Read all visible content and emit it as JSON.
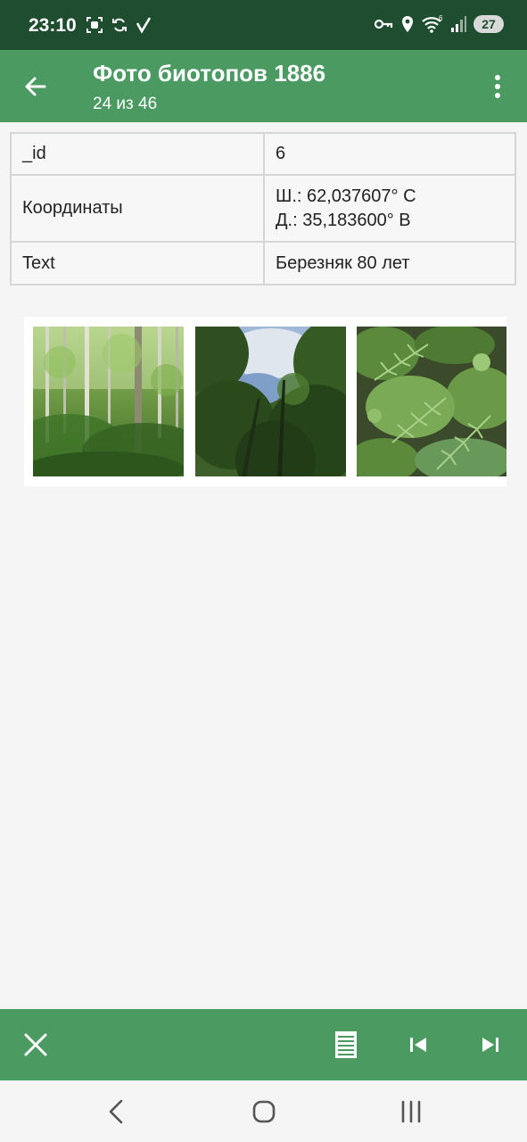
{
  "status_bar": {
    "time": "23:10",
    "battery": "27",
    "left_icons": [
      "screen-record-icon",
      "sync-icon",
      "checkmark-icon"
    ],
    "right_icons": [
      "vpn-key-icon",
      "location-icon",
      "wifi-icon",
      "signal-icon",
      "battery-icon"
    ]
  },
  "app_bar": {
    "title": "Фото биотопов 1886",
    "subtitle": "24 из 46",
    "back_icon": "arrow-back-icon",
    "menu_icon": "more-vert-icon",
    "color": "#4a9a62"
  },
  "details": {
    "rows": [
      {
        "key": "_id",
        "value": "6"
      },
      {
        "key": "Координаты",
        "value_lines": [
          "Ш.: 62,037607° С",
          "Д.: 35,183600° В"
        ]
      },
      {
        "key": "Text",
        "value": "Березняк 80 лет"
      }
    ]
  },
  "gallery": {
    "photos": [
      {
        "subject": "birch forest"
      },
      {
        "subject": "tree canopy and sky"
      },
      {
        "subject": "ferns on forest floor"
      }
    ]
  },
  "bottom_bar": {
    "buttons": [
      "close-icon",
      "list-view-icon",
      "skip-previous-icon",
      "skip-next-icon"
    ]
  },
  "nav_bar": {
    "buttons": [
      "nav-back-icon",
      "nav-home-icon",
      "nav-recents-icon"
    ]
  },
  "colors": {
    "status_bar": "#1e4d30",
    "accent": "#4a9a62",
    "background": "#f5f5f5"
  }
}
